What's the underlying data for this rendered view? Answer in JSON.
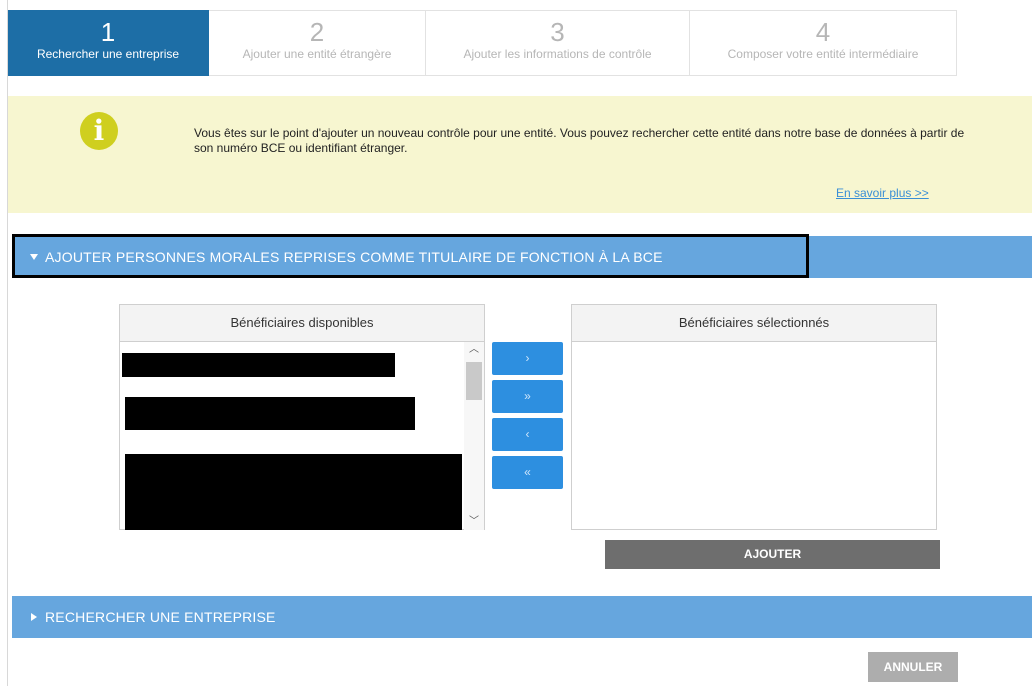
{
  "stepper": {
    "steps": [
      {
        "number": "1",
        "label": "Rechercher une entreprise"
      },
      {
        "number": "2",
        "label": "Ajouter une entité étrangère"
      },
      {
        "number": "3",
        "label": "Ajouter les informations de contrôle"
      },
      {
        "number": "4",
        "label": "Composer votre entité intermédiaire"
      }
    ]
  },
  "info": {
    "icon": "info-icon",
    "text": "Vous êtes sur le point d'ajouter un nouveau contrôle pour une entité. Vous pouvez rechercher cette entité dans notre base de données à partir de son numéro BCE ou identifiant étranger.",
    "link": "En savoir plus >>"
  },
  "section_ajouter": {
    "title": "AJOUTER PERSONNES MORALES REPRISES COMME TITULAIRE DE FONCTION À LA BCE"
  },
  "lists": {
    "available_header": "Bénéficiaires disponibles",
    "selected_header": "Bénéficiaires sélectionnés"
  },
  "transfer": {
    "move_one_right": "›",
    "move_all_right": "»",
    "move_one_left": "‹",
    "move_all_left": "«"
  },
  "actions": {
    "ajouter": "AJOUTER",
    "annuler": "ANNULER"
  },
  "section_rechercher": {
    "title": "RECHERCHER UNE ENTREPRISE"
  },
  "colors": {
    "active_step": "#1d6ea6",
    "info_bg": "#f7f6d0",
    "section_bar": "#66a6de",
    "transfer_button": "#2d8fe0",
    "primary_button": "#6e6e6e",
    "secondary_button": "#adadad"
  }
}
